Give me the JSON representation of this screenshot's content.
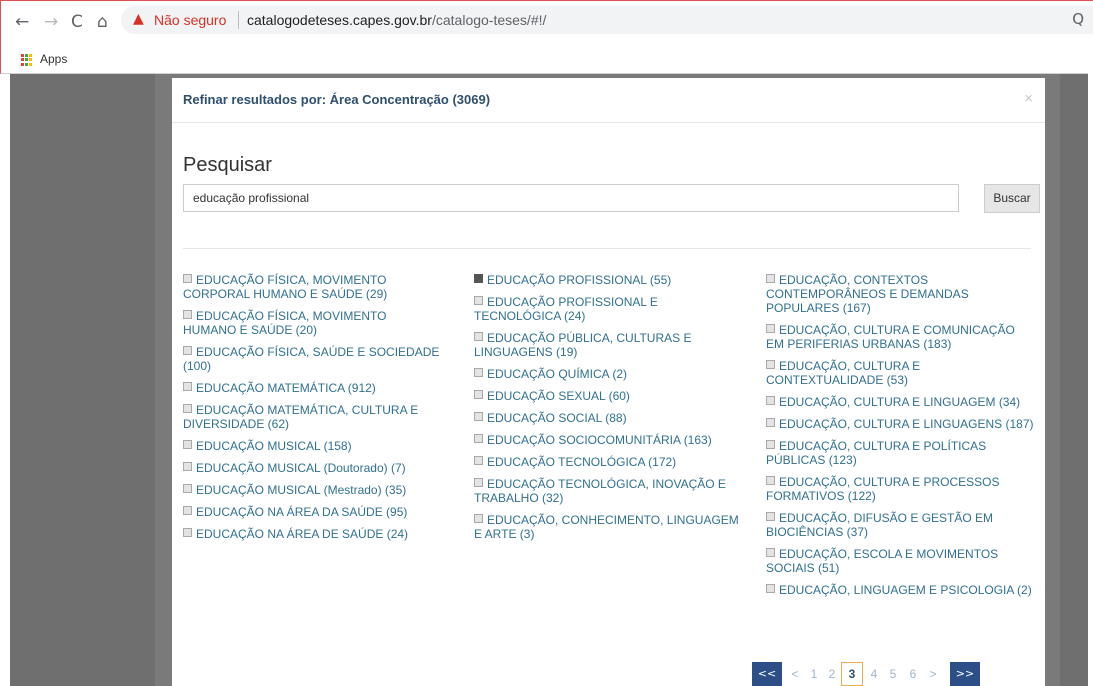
{
  "browser": {
    "back_glyph": "←",
    "forward_glyph": "→",
    "reload_glyph": "C",
    "home_glyph": "⌂",
    "warning_glyph": "▲",
    "security_label": "Não seguro",
    "url_domain": "catalogodeteses.capes.gov.br",
    "url_path": "/catalogo-teses/#!/",
    "zoom_glyph": "Q",
    "bookmarks_apps_label": "Apps"
  },
  "modal": {
    "title": "Refinar resultados por: Área Concentração (3069)",
    "close_glyph": "×",
    "search_heading": "Pesquisar",
    "search_value": "educação profissional",
    "search_button": "Buscar"
  },
  "columns": [
    [
      {
        "label": "EDUCAÇÃO FÍSICA, MOVIMENTO CORPORAL HUMANO E SAÚDE (29)",
        "checked": false
      },
      {
        "label": "EDUCAÇÃO FÍSICA, MOVIMENTO HUMANO E SAÚDE (20)",
        "checked": false
      },
      {
        "label": "EDUCAÇÃO FÍSICA, SAÚDE E SOCIEDADE (100)",
        "checked": false
      },
      {
        "label": "EDUCAÇÃO MATEMÁTICA (912)",
        "checked": false
      },
      {
        "label": "EDUCAÇÃO MATEMÁTICA, CULTURA E DIVERSIDADE (62)",
        "checked": false
      },
      {
        "label": "EDUCAÇÃO MUSICAL (158)",
        "checked": false
      },
      {
        "label": "EDUCAÇÃO MUSICAL (Doutorado) (7)",
        "checked": false
      },
      {
        "label": "EDUCAÇÃO MUSICAL (Mestrado) (35)",
        "checked": false
      },
      {
        "label": "EDUCAÇÃO NA ÁREA DA SAÚDE (95)",
        "checked": false
      },
      {
        "label": "EDUCAÇÃO NA ÁREA DE SAÚDE (24)",
        "checked": false
      }
    ],
    [
      {
        "label": "EDUCAÇÃO PROFISSIONAL (55)",
        "checked": true
      },
      {
        "label": "EDUCAÇÃO PROFISSIONAL E TECNOLÓGICA (24)",
        "checked": false
      },
      {
        "label": "EDUCAÇÃO PÚBLICA, CULTURAS E LINGUAGENS (19)",
        "checked": false
      },
      {
        "label": "EDUCAÇÃO QUÍMICA (2)",
        "checked": false
      },
      {
        "label": "EDUCAÇÃO SEXUAL (60)",
        "checked": false
      },
      {
        "label": "EDUCAÇÃO SOCIAL (88)",
        "checked": false
      },
      {
        "label": "EDUCAÇÃO SOCIOCOMUNITÁRIA (163)",
        "checked": false
      },
      {
        "label": "EDUCAÇÃO TECNOLÓGICA (172)",
        "checked": false
      },
      {
        "label": "EDUCAÇÃO TECNOLÓGICA, INOVAÇÃO E TRABALHO (32)",
        "checked": false
      },
      {
        "label": "EDUCAÇÃO, CONHECIMENTO, LINGUAGEM E ARTE (3)",
        "checked": false
      }
    ],
    [
      {
        "label": "EDUCAÇÃO, CONTEXTOS CONTEMPORÂNEOS E DEMANDAS POPULARES (167)",
        "checked": false
      },
      {
        "label": "EDUCAÇÃO, CULTURA E COMUNICAÇÃO EM PERIFERIAS URBANAS (183)",
        "checked": false
      },
      {
        "label": "EDUCAÇÃO, CULTURA E CONTEXTUALIDADE (53)",
        "checked": false
      },
      {
        "label": "EDUCAÇÃO, CULTURA E LINGUAGEM (34)",
        "checked": false
      },
      {
        "label": "EDUCAÇÃO, CULTURA E LINGUAGENS (187)",
        "checked": false
      },
      {
        "label": "EDUCAÇÃO, CULTURA E POLÍTICAS PÚBLICAS (123)",
        "checked": false
      },
      {
        "label": "EDUCAÇÃO, CULTURA E PROCESSOS FORMATIVOS (122)",
        "checked": false
      },
      {
        "label": "EDUCAÇÃO, DIFUSÃO E GESTÃO EM BIOCIÊNCIAS (37)",
        "checked": false
      },
      {
        "label": "EDUCAÇÃO, ESCOLA E MOVIMENTOS SOCIAIS (51)",
        "checked": false
      },
      {
        "label": "EDUCAÇÃO, LINGUAGEM E PSICOLOGIA (2)",
        "checked": false
      }
    ]
  ],
  "pagination": {
    "first": "<<",
    "prev": "<",
    "pages": [
      "1",
      "2",
      "3",
      "4",
      "5",
      "6"
    ],
    "current": "3",
    "next": ">",
    "last": ">>"
  },
  "colors": {
    "link": "#31708f",
    "pager_nav": "#2c4f88",
    "current_page_border": "#f0ad4e",
    "warning": "#d93025"
  }
}
